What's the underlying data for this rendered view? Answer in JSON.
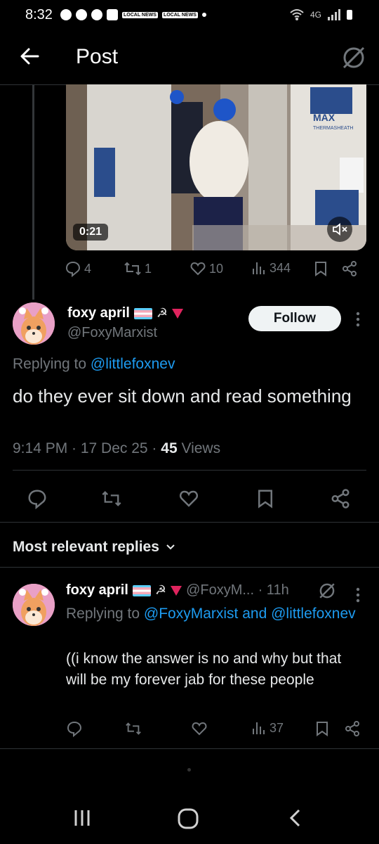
{
  "status_bar": {
    "time": "8:32",
    "news_label_1": "LOCAL NEWS",
    "news_label_2": "LOCAL NEWS",
    "network": "4G"
  },
  "header": {
    "title": "Post"
  },
  "video": {
    "duration": "0:21",
    "wall_text_1": "MAX",
    "wall_text_2": "THERMASHEATH"
  },
  "parent_actions": {
    "replies": "4",
    "reposts": "1",
    "likes": "10",
    "views": "344"
  },
  "post": {
    "author_name": "foxy april",
    "emoji_hs": "☭",
    "handle": "@FoxyMarxist",
    "follow_label": "Follow",
    "replying_prefix": "Replying to",
    "replying_to": "@littlefoxnev",
    "text": "do they ever sit down and read something",
    "time": "9:14 PM · 17 Dec 25 · ",
    "views_count": "45",
    "views_label": " Views"
  },
  "replies_section": {
    "sort_label": "Most relevant replies"
  },
  "reply": {
    "author_name": "foxy april",
    "emoji_hs": "☭",
    "handle_time": "@FoxyM... · 11h",
    "replying_prefix": "Replying to",
    "replying_to": "@FoxyMarxist and @littlefoxnev",
    "text": "((i know the answer is no and why but that will be my forever jab for these people",
    "views": "37"
  },
  "colors": {
    "accent": "#1d9bf0",
    "muted": "#71767b",
    "background": "#000000"
  }
}
